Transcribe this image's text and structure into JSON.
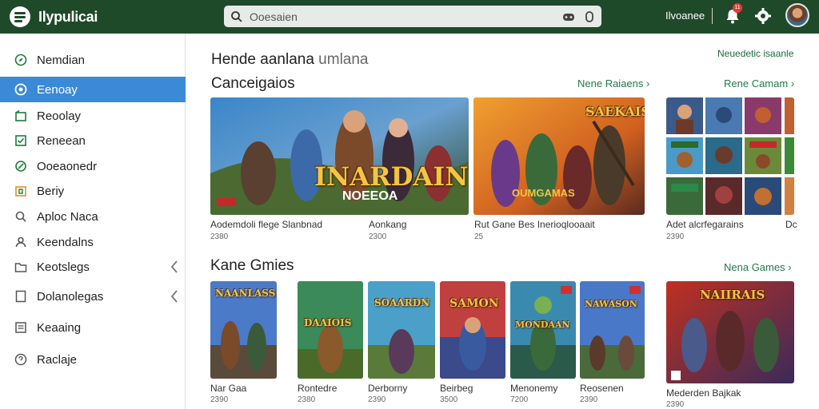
{
  "app": {
    "title": "Ilypulicai"
  },
  "search": {
    "placeholder": "Ooesaien"
  },
  "topbar": {
    "user_label": "Ilvoanee",
    "notification_count": "11"
  },
  "sidebar": {
    "items": [
      {
        "label": "Nemdian",
        "icon": "compass-icon",
        "active": false
      },
      {
        "label": "Eenoay",
        "icon": "discover-icon",
        "active": true
      },
      {
        "label": "Reoolay",
        "icon": "library-icon",
        "active": false
      },
      {
        "label": "Reneean",
        "icon": "check-square-icon",
        "active": false
      },
      {
        "label": "Ooeaonedr",
        "icon": "link-icon",
        "active": false
      },
      {
        "label": "Beriy",
        "icon": "gift-icon",
        "active": false
      },
      {
        "label": "Aploc Naca",
        "icon": "search-icon",
        "active": false
      },
      {
        "label": "Keendalns",
        "icon": "user-icon",
        "active": false
      },
      {
        "label": "Keotslegs",
        "icon": "folder-icon",
        "active": false
      },
      {
        "label": "Dolanolegas",
        "icon": "document-icon",
        "active": false
      },
      {
        "label": "Keaaing",
        "icon": "list-icon",
        "active": false
      },
      {
        "label": "Raclaje",
        "icon": "help-icon",
        "active": false
      }
    ]
  },
  "main": {
    "title": "Hende aanlana",
    "title_sub": "umlana",
    "top_link": "Neuedetic isaanle",
    "sections": [
      {
        "title": "Canceigaios",
        "links": [
          "Nene Raiaens",
          "Rene Camam"
        ],
        "cards": [
          {
            "title": "Aodemdoli flege Slanbnad",
            "sub": "2380",
            "cover_title": "INARDAIN",
            "cover_sub": "NOEEOA"
          },
          {
            "title": "Aonkang",
            "sub": "2300",
            "cover_title": "",
            "cover_sub": ""
          },
          {
            "title": "Rut Gane Bes Inerioqlooaait",
            "sub": "25",
            "cover_title": "SAEKAIS",
            "cover_sub": "OUMGAMAS"
          },
          {
            "title": "Adet alcrfegarains",
            "sub": "2390",
            "cover_title": "",
            "cover_sub": ""
          },
          {
            "title": "Dc",
            "sub": "",
            "cover_title": "",
            "cover_sub": ""
          }
        ]
      },
      {
        "title": "Kane Gmies",
        "links": [
          "Nena Games"
        ],
        "cards": [
          {
            "title": "Nar Gaa",
            "sub": "2390",
            "cover_title": "NAANLASS",
            "cover_sub": ""
          },
          {
            "title": "Rontedre",
            "sub": "2380",
            "cover_title": "DAAIOIS",
            "cover_sub": ""
          },
          {
            "title": "Derborny",
            "sub": "2390",
            "cover_title": "SOAARDN",
            "cover_sub": ""
          },
          {
            "title": "Beirbeg",
            "sub": "3500",
            "cover_title": "SAMON",
            "cover_sub": ""
          },
          {
            "title": "Menonemy",
            "sub": "7200",
            "cover_title": "MONDAAN",
            "cover_sub": ""
          },
          {
            "title": "Reosenen",
            "sub": "2390",
            "cover_title": "NAWASON",
            "cover_sub": ""
          },
          {
            "title": "Mederden Bajkak",
            "sub": "2390",
            "cover_title": "NAIIRAIS",
            "cover_sub": ""
          }
        ]
      }
    ]
  },
  "colors": {
    "topbar": "#1f4a2a",
    "active": "#3a8ad8",
    "link": "#1f7a4a"
  }
}
